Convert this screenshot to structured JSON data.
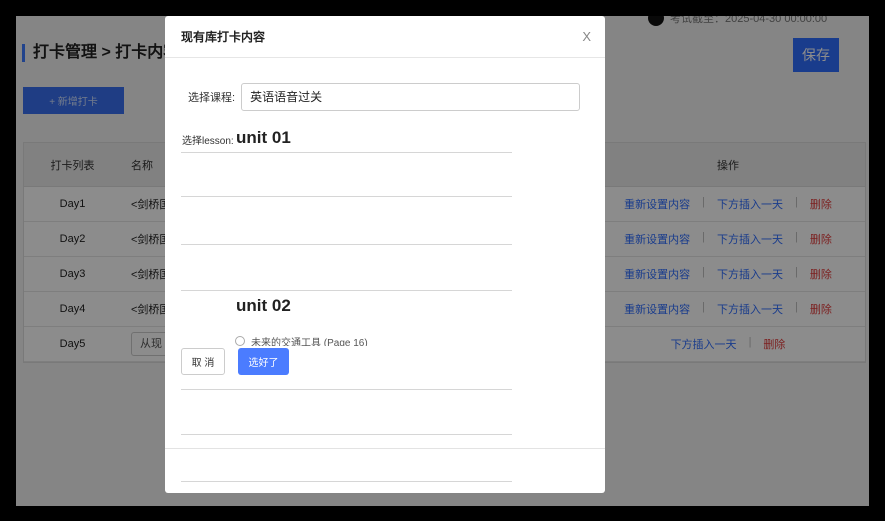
{
  "page": {
    "top_info": "考试截至：2025-04-30 00:00:00",
    "title": "打卡管理 > 打卡内容列",
    "save_label": "保存",
    "add_label": "+ 新增打卡"
  },
  "table": {
    "headers": [
      "打卡列表",
      "名称",
      "操作"
    ],
    "rows": [
      {
        "day": "Day1",
        "name": "<剑桥国",
        "reset": "重新设置内容",
        "insert": "下方插入一天",
        "delete": "删除"
      },
      {
        "day": "Day2",
        "name": "<剑桥国",
        "reset": "重新设置内容",
        "insert": "下方插入一天",
        "delete": "删除"
      },
      {
        "day": "Day3",
        "name": "<剑桥国",
        "reset": "重新设置内容",
        "insert": "下方插入一天",
        "delete": "删除"
      },
      {
        "day": "Day4",
        "name": "<剑桥国",
        "reset": "重新设置内容",
        "insert": "下方插入一天",
        "delete": "删除"
      }
    ],
    "last_row": {
      "day": "Day5",
      "picker": "从现",
      "insert": "下方插入一天",
      "delete": "删除"
    },
    "separator": "|"
  },
  "modal": {
    "title": "现有库打卡内容",
    "close_label": "X",
    "course_label": "选择课程:",
    "course_value": "英语语音过关",
    "lesson_label": "选择lesson:",
    "units": [
      "unit 01",
      "unit 02"
    ],
    "option_label": "未来的交通工具 (Page 16)",
    "cancel_label": "取 消",
    "confirm_label": "选好了"
  }
}
